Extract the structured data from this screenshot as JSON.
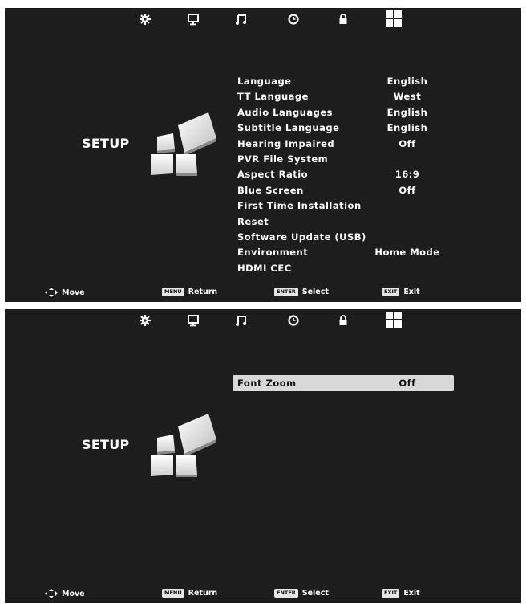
{
  "top_icons": [
    "gear-icon",
    "monitor-icon",
    "music-note-icon",
    "clock-icon",
    "lock-icon",
    "grid-setup-icon"
  ],
  "setup_title": "SETUP",
  "screen1": {
    "menu": [
      {
        "label": "Language",
        "value": "English"
      },
      {
        "label": "TT Language",
        "value": "West"
      },
      {
        "label": "Audio Languages",
        "value": "English"
      },
      {
        "label": "Subtitle Language",
        "value": "English"
      },
      {
        "label": "Hearing Impaired",
        "value": "Off"
      },
      {
        "label": "PVR File System",
        "value": ""
      },
      {
        "label": "Aspect Ratio",
        "value": "16:9"
      },
      {
        "label": "Blue Screen",
        "value": "Off"
      },
      {
        "label": "First Time Installation",
        "value": ""
      },
      {
        "label": "Reset",
        "value": ""
      },
      {
        "label": "Software Update (USB)",
        "value": ""
      },
      {
        "label": "Environment",
        "value": "Home Mode"
      },
      {
        "label": "HDMI CEC",
        "value": ""
      }
    ]
  },
  "screen2": {
    "menu": [
      {
        "label": "Font Zoom",
        "value": "Off",
        "selected": true
      }
    ]
  },
  "help": {
    "move": "Move",
    "menu_key": "MENU",
    "return": "Return",
    "enter_key": "ENTER",
    "select": "Select",
    "exit_key": "EXIT",
    "exit": "Exit"
  },
  "colors": {
    "background": "#1d1d1d",
    "text": "#ffffff",
    "highlight": "#d8d8d8"
  }
}
